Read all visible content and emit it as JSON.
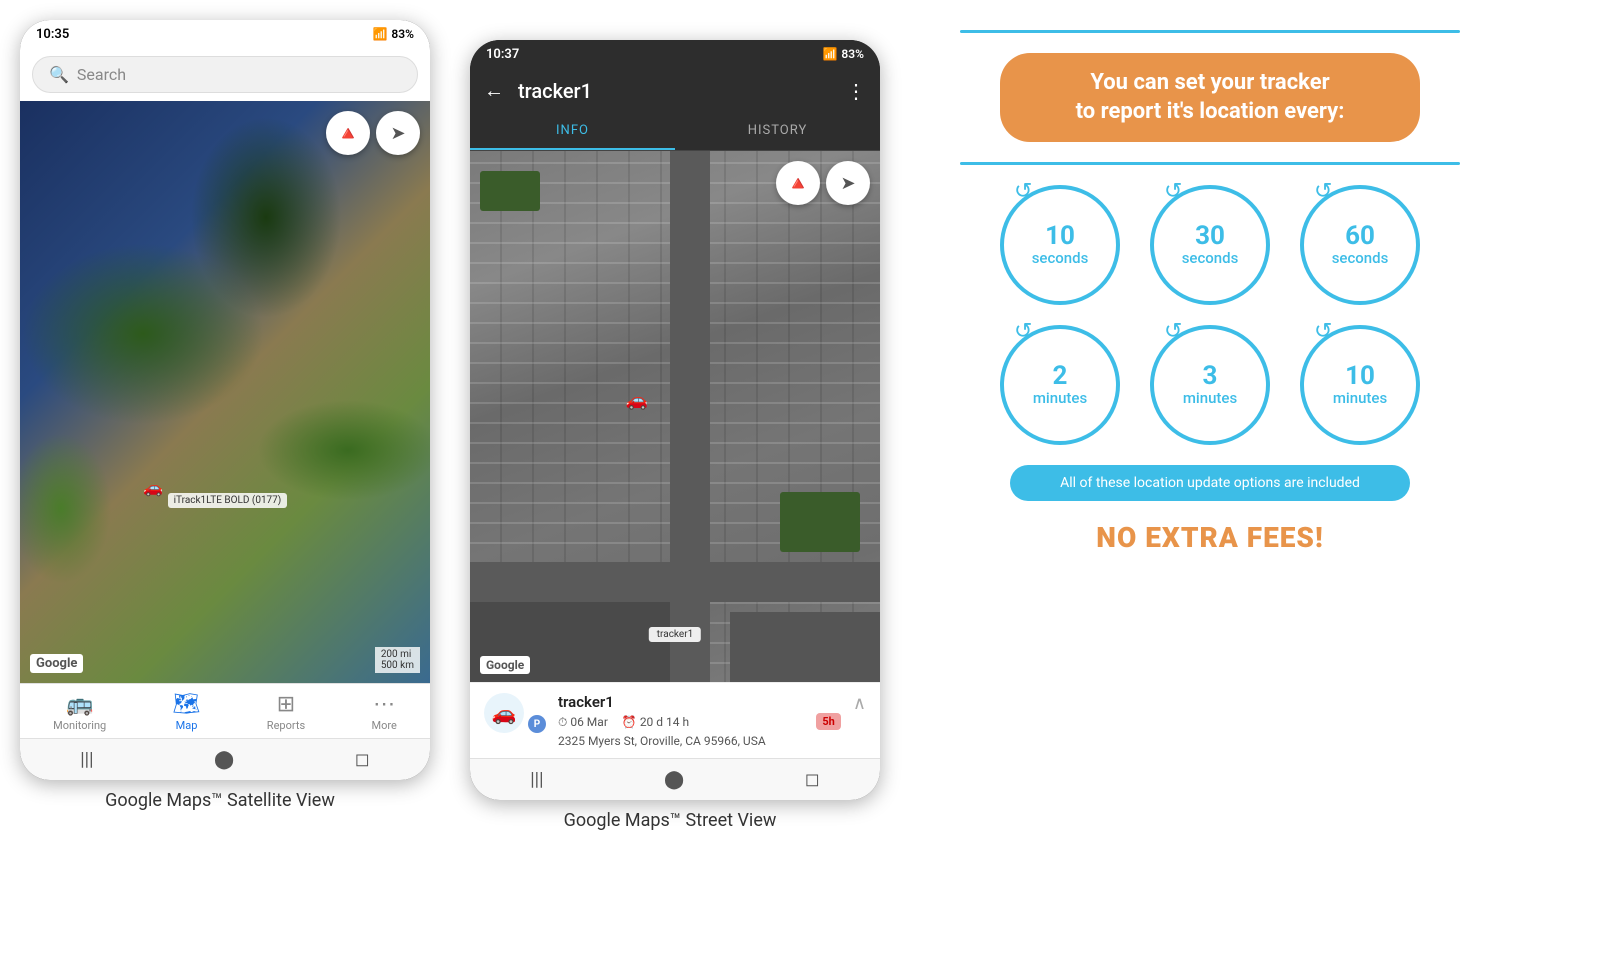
{
  "left_phone": {
    "status_bar": {
      "time": "10:35",
      "signal": "📶",
      "battery": "83%"
    },
    "search": {
      "placeholder": "Search"
    },
    "map": {
      "compass_icon": "🧭",
      "location_icon": "➤",
      "google_label": "Google",
      "scale_label": "200 mi\n500 km",
      "tracker_label": "iTrack1LTE BOLD (0177)"
    },
    "nav": {
      "items": [
        {
          "label": "Monitoring",
          "icon": "🚌",
          "active": false
        },
        {
          "label": "Map",
          "icon": "🗺",
          "active": true
        },
        {
          "label": "Reports",
          "icon": "⊞",
          "active": false
        },
        {
          "label": "More",
          "icon": "⋯",
          "active": false
        }
      ]
    },
    "caption": "Google Maps™ Satellite View"
  },
  "right_phone": {
    "status_bar": {
      "time": "10:37",
      "battery": "83%"
    },
    "header": {
      "back_icon": "←",
      "title": "tracker1",
      "menu_icon": "⋮"
    },
    "tabs": [
      {
        "label": "INFO",
        "active": true
      },
      {
        "label": "HISTORY",
        "active": false
      }
    ],
    "map": {
      "compass_icon": "🧭",
      "location_icon": "➤",
      "google_label": "Google",
      "tracker_popup": "tracker1"
    },
    "tracker_info": {
      "name": "tracker1",
      "p_badge": "P",
      "date": "06 Mar",
      "duration": "20 d 14 h",
      "address": "2325 Myers St, Oroville, CA 95966, USA",
      "time_badge": "5h"
    },
    "caption": "Google Maps™ Street View"
  },
  "info_panel": {
    "header_text": "You can set your tracker\nto report it's location every:",
    "intervals_row1": [
      {
        "number": "10",
        "unit": "seconds"
      },
      {
        "number": "30",
        "unit": "seconds"
      },
      {
        "number": "60",
        "unit": "seconds"
      }
    ],
    "intervals_row2": [
      {
        "number": "2",
        "unit": "minutes"
      },
      {
        "number": "3",
        "unit": "minutes"
      },
      {
        "number": "10",
        "unit": "minutes"
      }
    ],
    "bottom_text": "All of these location update options are included",
    "no_fees_text": "NO EXTRA FEES!"
  }
}
